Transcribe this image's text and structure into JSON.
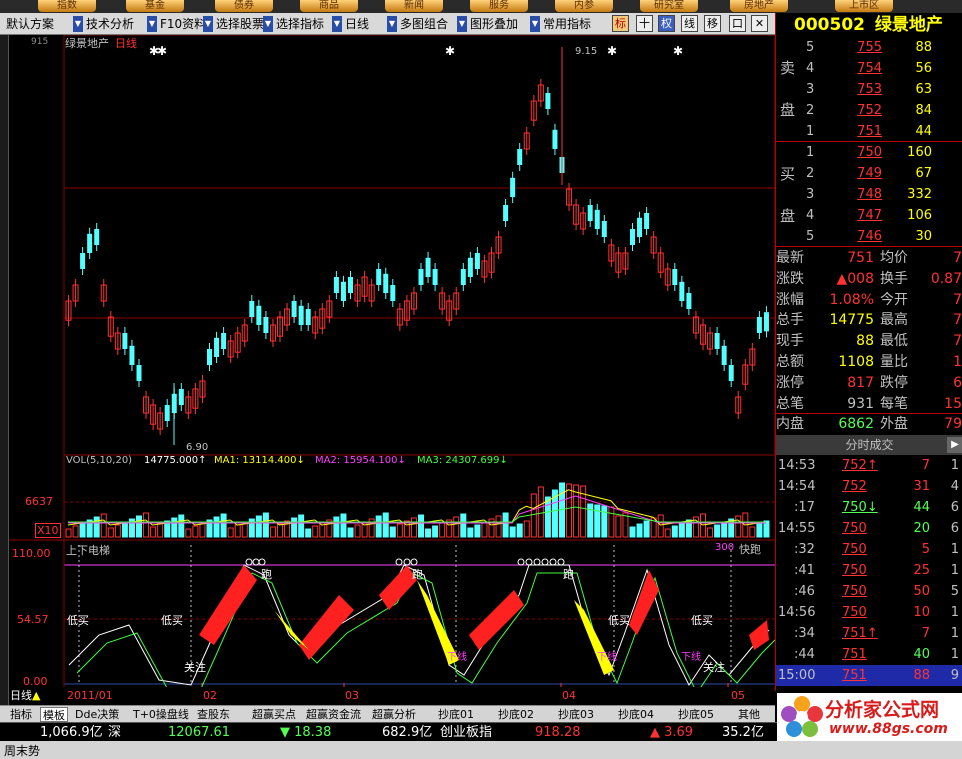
{
  "topnav": [
    "指数",
    "基金",
    "债券",
    "商品",
    "新闻",
    "服务",
    "内参",
    "研究室",
    "房地产",
    "上市区"
  ],
  "toolbar": {
    "items": [
      "默认方案",
      "技术分析",
      "F10资料",
      "选择股票",
      "选择指标",
      "日线",
      "多图组合",
      "图形叠加",
      "常用指标"
    ],
    "icons": [
      "标",
      "十",
      "权",
      "线",
      "移",
      "口",
      "✕"
    ]
  },
  "chart": {
    "title": "绿景地产",
    "period": "日线",
    "axis_top": "915",
    "max_label": "9.15",
    "min_label": "6.90",
    "vol_header": "VOL(5,10,20)",
    "vol_value": "14775.000↑",
    "ma1": "MA1: 13114.400↓",
    "ma2": "MA2: 15954.100↓",
    "ma3": "MA3: 24307.699↓",
    "vol_axis": "6637",
    "vol_mult": "X10",
    "ind_title": "上下电梯",
    "ind_axis_top": "110.00",
    "ind_axis_mid": "54.57",
    "ind_axis_bot": "0.00",
    "ind_right": "300",
    "ind_fast": "快跑",
    "labels_low_buy": "低买",
    "label_run": "跑",
    "label_focus": "关注",
    "label_down": "下线",
    "months": [
      "2011/01",
      "02",
      "03",
      "04",
      "05"
    ],
    "period_tag": "日线"
  },
  "right_panel": {
    "code": "000502",
    "name": "绿景地产",
    "sell_label": [
      "卖",
      "盘"
    ],
    "buy_label": [
      "买",
      "盘"
    ],
    "sell": [
      {
        "lvl": "5",
        "price": "755",
        "vol": "88"
      },
      {
        "lvl": "4",
        "price": "754",
        "vol": "56"
      },
      {
        "lvl": "3",
        "price": "753",
        "vol": "63"
      },
      {
        "lvl": "2",
        "price": "752",
        "vol": "84"
      },
      {
        "lvl": "1",
        "price": "751",
        "vol": "44"
      }
    ],
    "buy": [
      {
        "lvl": "1",
        "price": "750",
        "vol": "160"
      },
      {
        "lvl": "2",
        "price": "749",
        "vol": "67"
      },
      {
        "lvl": "3",
        "price": "748",
        "vol": "332"
      },
      {
        "lvl": "4",
        "price": "747",
        "vol": "106"
      },
      {
        "lvl": "5",
        "price": "746",
        "vol": "30"
      }
    ],
    "stats": [
      {
        "k1": "最新",
        "v1": "751",
        "k2": "均价",
        "v2": "7"
      },
      {
        "k1": "涨跌",
        "v1": "▲008",
        "k2": "换手",
        "v2": "0.87"
      },
      {
        "k1": "涨幅",
        "v1": "1.08%",
        "k2": "今开",
        "v2": "7"
      },
      {
        "k1": "总手",
        "v1": "14775",
        "k2": "最高",
        "v2": "7"
      },
      {
        "k1": "现手",
        "v1": "88",
        "k2": "最低",
        "v2": "7"
      },
      {
        "k1": "总额",
        "v1": "1108",
        "k2": "量比",
        "v2": "1"
      },
      {
        "k1": "涨停",
        "v1": "817",
        "k2": "跌停",
        "v2": "6"
      },
      {
        "k1": "总笔",
        "v1": "931",
        "k2": "每笔",
        "v2": "15"
      },
      {
        "k1": "内盘",
        "v1": "6862",
        "k2": "外盘",
        "v2": "79"
      }
    ],
    "ticks_header": "分时成交",
    "ticks": [
      {
        "t": "14:53",
        "p": "752↑",
        "v": "7",
        "n": "1"
      },
      {
        "t": "14:54",
        "p": "752",
        "v": "31",
        "n": "4"
      },
      {
        "t": ":17",
        "p": "750↓",
        "v": "44",
        "n": "6"
      },
      {
        "t": "14:55",
        "p": "750",
        "v": "20",
        "n": "6"
      },
      {
        "t": ":32",
        "p": "750",
        "v": "5",
        "n": "1"
      },
      {
        "t": ":41",
        "p": "750",
        "v": "25",
        "n": "1"
      },
      {
        "t": ":46",
        "p": "750",
        "v": "50",
        "n": "5"
      },
      {
        "t": "14:56",
        "p": "750",
        "v": "10",
        "n": "1"
      },
      {
        "t": ":34",
        "p": "751↑",
        "v": "7",
        "n": "1"
      },
      {
        "t": ":44",
        "p": "751",
        "v": "40",
        "n": "1"
      },
      {
        "t": "15:00",
        "p": "751",
        "v": "88",
        "n": "9"
      }
    ]
  },
  "tabs": [
    "指标",
    "模板",
    "Dde决策",
    "T+0操盘线",
    "查股东",
    "超赢买点",
    "超赢资金流",
    "超赢分析",
    "抄底01",
    "抄底02",
    "抄底03",
    "抄底04",
    "抄底05",
    "其他"
  ],
  "ticker": {
    "a_val": "1,066.9亿",
    "a_name": "深",
    "b_val": "12067.61",
    "c_val": "▼ 18.38",
    "d_val": "682.9亿",
    "d_name": "创业板指",
    "e_val": "918.28",
    "f_val": "▲ 3.69",
    "g_val": "35.2亿"
  },
  "status": "周末势",
  "logo": {
    "title": "分析家公式网",
    "url": "www.88gs.com"
  },
  "colors": {
    "up": "#ff3232",
    "down": "#54ffff",
    "yellow": "#ffff00",
    "grid": "#8b0000",
    "bg": "#000000"
  },
  "chart_data": {
    "type": "candlestick",
    "title": "绿景地产",
    "period": "日线",
    "price_max": 9.15,
    "price_min": 6.9,
    "months": [
      "2011/01",
      "02",
      "03",
      "04",
      "05"
    ],
    "volume_ma": {
      "ma1": 13114.4,
      "ma2": 15954.1,
      "ma3": 24307.699,
      "vol": 14775.0
    },
    "indicator": {
      "name": "上下电梯",
      "range": [
        0,
        110
      ]
    }
  }
}
